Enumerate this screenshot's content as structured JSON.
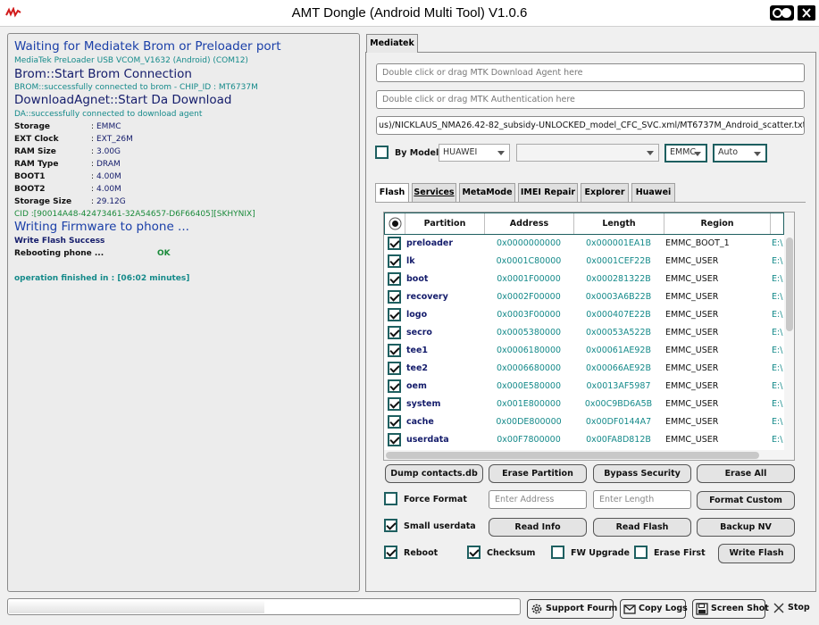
{
  "window": {
    "title": "AMT Dongle (Android Multi Tool) V1.0.6"
  },
  "log": {
    "line1": "Waiting for Mediatek Brom or Preloader port",
    "line2": "MediaTek PreLoader USB VCOM_V1632 (Android) (COM12)",
    "line3": "Brom::Start Brom Connection",
    "line4": "BROM::successfully connected to brom - CHIP_ID : MT6737M",
    "line5": "DownloadAgnet::Start Da Download",
    "line6": "DA::successfully connected to download agent",
    "info": [
      {
        "key": "Storage",
        "value": "EMMC"
      },
      {
        "key": "EXT Clock",
        "value": "EXT_26M"
      },
      {
        "key": "RAM Size",
        "value": "3.00G"
      },
      {
        "key": "RAM Type",
        "value": "DRAM"
      },
      {
        "key": "BOOT1",
        "value": "4.00M"
      },
      {
        "key": "BOOT2",
        "value": "4.00M"
      },
      {
        "key": "Storage Size",
        "value": "29.12G"
      }
    ],
    "separator": ":",
    "cid": "CID :[90014A48-42473461-32A54657-D6F66405][SKHYNIX]",
    "writing": "Writing Firmware to phone ...",
    "write_success": "Write Flash Success",
    "rebooting": "Rebooting phone ...",
    "rebooting_status": "OK",
    "finished": "operation finished in : [06:02 minutes]"
  },
  "main_tab": "Mediatek",
  "fields": {
    "download_agent_placeholder": "Double click or drag MTK Download Agent here",
    "auth_placeholder": "Double click or drag MTK Authentication here",
    "scatter_path": "us)/NICKLAUS_NMA26.42-82_subsidy-UNLOCKED_model_CFC_SVC.xml/MT6737M_Android_scatter.txt"
  },
  "by_model": {
    "label": "By Model",
    "brand": "HUAWEI",
    "model": "",
    "storage": "EMMC",
    "mode": "Auto"
  },
  "subtabs": [
    "Flash",
    "Services",
    "MetaMode",
    "IMEI Repair",
    "Explorer",
    "Huawei"
  ],
  "table": {
    "headers": [
      "Partition",
      "Address",
      "Length",
      "Region"
    ],
    "rows": [
      {
        "partition": "preloader",
        "address": "0x0000000000",
        "length": "0x000001EA1B",
        "region": "EMMC_BOOT_1",
        "extra": "E:\\"
      },
      {
        "partition": "lk",
        "address": "0x0001C80000",
        "length": "0x0001CEF22B",
        "region": "EMMC_USER",
        "extra": "E:\\"
      },
      {
        "partition": "boot",
        "address": "0x0001F00000",
        "length": "0x000281322B",
        "region": "EMMC_USER",
        "extra": "E:\\"
      },
      {
        "partition": "recovery",
        "address": "0x0002F00000",
        "length": "0x0003A6B22B",
        "region": "EMMC_USER",
        "extra": "E:\\"
      },
      {
        "partition": "logo",
        "address": "0x0003F00000",
        "length": "0x000407E22B",
        "region": "EMMC_USER",
        "extra": "E:\\"
      },
      {
        "partition": "secro",
        "address": "0x0005380000",
        "length": "0x00053A522B",
        "region": "EMMC_USER",
        "extra": "E:\\"
      },
      {
        "partition": "tee1",
        "address": "0x0006180000",
        "length": "0x00061AE92B",
        "region": "EMMC_USER",
        "extra": "E:\\"
      },
      {
        "partition": "tee2",
        "address": "0x0006680000",
        "length": "0x00066AE92B",
        "region": "EMMC_USER",
        "extra": "E:\\"
      },
      {
        "partition": "oem",
        "address": "0x000E580000",
        "length": "0x0013AF5987",
        "region": "EMMC_USER",
        "extra": "E:\\"
      },
      {
        "partition": "system",
        "address": "0x001E800000",
        "length": "0x00C9BD6A5B",
        "region": "EMMC_USER",
        "extra": "E:\\"
      },
      {
        "partition": "cache",
        "address": "0x00DE800000",
        "length": "0x00DF0144A7",
        "region": "EMMC_USER",
        "extra": "E:\\"
      },
      {
        "partition": "userdata",
        "address": "0x00F7800000",
        "length": "0x00FA8D812B",
        "region": "EMMC_USER",
        "extra": "E:\\"
      }
    ]
  },
  "buttons": {
    "dump_contacts": "Dump contacts.db",
    "erase_partition": "Erase Partition",
    "bypass_security": "Bypass Security",
    "erase_all": "Erase All",
    "format_custom": "Format Custom",
    "read_info": "Read Info",
    "read_flash": "Read Flash",
    "backup_nv": "Backup NV",
    "write_flash": "Write Flash"
  },
  "options": {
    "force_format": "Force Format",
    "small_userdata": "Small userdata",
    "reboot": "Reboot",
    "checksum": "Checksum",
    "fw_upgrade": "FW Upgrade",
    "erase_first": "Erase First",
    "enter_address_placeholder": "Enter Address",
    "enter_length_placeholder": "Enter Length"
  },
  "bottom": {
    "progress": 0.5,
    "support_forum": "Support Fourm",
    "copy_logs": "Copy Logs",
    "screen_shot": "Screen Shot",
    "stop": "Stop"
  },
  "colors": {
    "accent": "#1e5f60",
    "log_blue": "#1a3fa8",
    "log_teal": "#158a8a",
    "log_green": "#1a8a3a"
  }
}
